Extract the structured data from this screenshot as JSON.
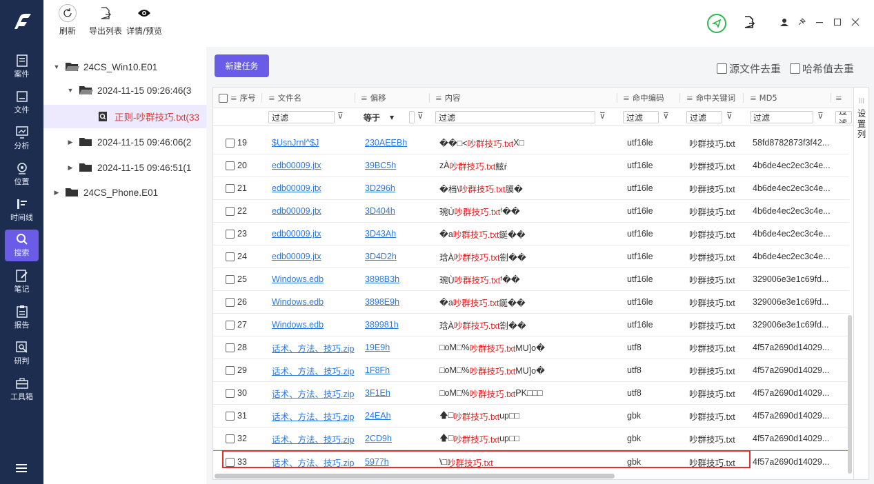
{
  "toolbar": {
    "refresh": "刷新",
    "export": "导出列表",
    "detail": "详情/预览"
  },
  "rail": [
    {
      "label": "案件",
      "icon": "case-icon"
    },
    {
      "label": "文件",
      "icon": "file-icon"
    },
    {
      "label": "分析",
      "icon": "analysis-icon"
    },
    {
      "label": "位置",
      "icon": "location-icon"
    },
    {
      "label": "时间线",
      "icon": "timeline-icon"
    },
    {
      "label": "搜索",
      "icon": "search-icon"
    },
    {
      "label": "笔记",
      "icon": "note-icon"
    },
    {
      "label": "报告",
      "icon": "report-icon"
    },
    {
      "label": "研判",
      "icon": "judge-icon"
    },
    {
      "label": "工具箱",
      "icon": "toolbox-icon"
    }
  ],
  "tree": [
    {
      "label": "24CS_Win10.E01"
    },
    {
      "label": "2024-11-15 09:26:46(3"
    },
    {
      "label": "正则-吵群技巧.txt(33"
    },
    {
      "label": "2024-11-15 09:46:06(2"
    },
    {
      "label": "2024-11-15 09:46:51(1"
    },
    {
      "label": "24CS_Phone.E01"
    }
  ],
  "main": {
    "new_task": "新建任务",
    "dedup_src": "源文件去重",
    "dedup_hash": "哈希值去重",
    "side_tab": "设置列",
    "headers": {
      "seq": "序号",
      "name": "文件名",
      "offset": "偏移",
      "content": "内容",
      "encoding": "命中编码",
      "keyword": "命中关键词",
      "md5": "MD5"
    },
    "filter": {
      "ph": "过滤",
      "eq": "等于"
    }
  },
  "rows": [
    {
      "seq": "19",
      "name": "$UsnJrnl^$J",
      "offset": "230AEEBh",
      "pre": "��□<",
      "hit": "吵群技巧.txt",
      "post": "X□",
      "enc": "utf16le",
      "kw": "吵群技巧.txt",
      "md5": "58fd8782873f3f42..."
    },
    {
      "seq": "20",
      "name": "edb00009.jtx",
      "offset": "39BC5h",
      "pre": "zÀ",
      "hit": "吵群技巧.txt",
      "post": "鮌ŕ",
      "enc": "utf16le",
      "kw": "吵群技巧.txt",
      "md5": "4b6de4ec2ec3c4e..."
    },
    {
      "seq": "21",
      "name": "edb00009.jtx",
      "offset": "3D296h",
      "pre": "�档\\",
      "hit": "吵群技巧.txt",
      "post": "膜�",
      "enc": "utf16le",
      "kw": "吵群技巧.txt",
      "md5": "4b6de4ec2ec3c4e..."
    },
    {
      "seq": "22",
      "name": "edb00009.jtx",
      "offset": "3D404h",
      "pre": "琬Ù",
      "hit": "吵群技巧.txt",
      "post": "ᶠ��",
      "enc": "utf16le",
      "kw": "吵群技巧.txt",
      "md5": "4b6de4ec2ec3c4e..."
    },
    {
      "seq": "23",
      "name": "edb00009.jtx",
      "offset": "3D43Ah",
      "pre": "�a",
      "hit": "吵群技巧.txt",
      "post": "鋋��",
      "enc": "utf16le",
      "kw": "吵群技巧.txt",
      "md5": "4b6de4ec2ec3c4e..."
    },
    {
      "seq": "24",
      "name": "edb00009.jtx",
      "offset": "3D4D2h",
      "pre": "琀À",
      "hit": "吵群技巧.txt",
      "post": "劄��",
      "enc": "utf16le",
      "kw": "吵群技巧.txt",
      "md5": "4b6de4ec2ec3c4e..."
    },
    {
      "seq": "25",
      "name": "Windows.edb",
      "offset": "3898B3h",
      "pre": "琬Ù",
      "hit": "吵群技巧.txt",
      "post": "ᶠ��",
      "enc": "utf16le",
      "kw": "吵群技巧.txt",
      "md5": "329006e3e1c69fd..."
    },
    {
      "seq": "26",
      "name": "Windows.edb",
      "offset": "3898E9h",
      "pre": "�a",
      "hit": "吵群技巧.txt",
      "post": "鋋��",
      "enc": "utf16le",
      "kw": "吵群技巧.txt",
      "md5": "329006e3e1c69fd..."
    },
    {
      "seq": "27",
      "name": "Windows.edb",
      "offset": "389981h",
      "pre": "琀À",
      "hit": "吵群技巧.txt",
      "post": "劄��",
      "enc": "utf16le",
      "kw": "吵群技巧.txt",
      "md5": "329006e3e1c69fd..."
    },
    {
      "seq": "28",
      "name": "话术、方法、技巧.zip",
      "offset": "19E9h",
      "pre": "□oM□%",
      "hit": "吵群技巧.txt",
      "post": "MU]o�",
      "enc": "utf8",
      "kw": "吵群技巧.txt",
      "md5": "4f57a2690d14029..."
    },
    {
      "seq": "29",
      "name": "话术、方法、技巧.zip",
      "offset": "1F8Fh",
      "pre": "□oM□%",
      "hit": "吵群技巧.txt",
      "post": "MU]o�",
      "enc": "utf8",
      "kw": "吵群技巧.txt",
      "md5": "4f57a2690d14029..."
    },
    {
      "seq": "30",
      "name": "话术、方法、技巧.zip",
      "offset": "3F1Eh",
      "pre": "□oM□%",
      "hit": "吵群技巧.txt",
      "post": "PK□□□",
      "enc": "utf8",
      "kw": "吵群技巧.txt",
      "md5": "4f57a2690d14029..."
    },
    {
      "seq": "31",
      "name": "话术、方法、技巧.zip",
      "offset": "24EAh",
      "pre": "🡅□",
      "hit": "吵群技巧.txt",
      "post": "up□□",
      "enc": "gbk",
      "kw": "吵群技巧.txt",
      "md5": "4f57a2690d14029..."
    },
    {
      "seq": "32",
      "name": "话术、方法、技巧.zip",
      "offset": "2CD9h",
      "pre": "🡅□",
      "hit": "吵群技巧.txt",
      "post": "up□□",
      "enc": "gbk",
      "kw": "吵群技巧.txt",
      "md5": "4f57a2690d14029..."
    },
    {
      "seq": "33",
      "name": "话术、方法、技巧.zip",
      "offset": "5977h",
      "pre": "\\□",
      "hit": "吵群技巧.txt",
      "post": "",
      "enc": "gbk",
      "kw": "吵群技巧.txt",
      "md5": "4f57a2690d14029..."
    }
  ],
  "colors": {
    "rail": "#1c2d4f",
    "accent": "#6a5ce6",
    "highlight": "#e02020",
    "link": "#2a7ae2",
    "status_ok": "#2db84d"
  }
}
